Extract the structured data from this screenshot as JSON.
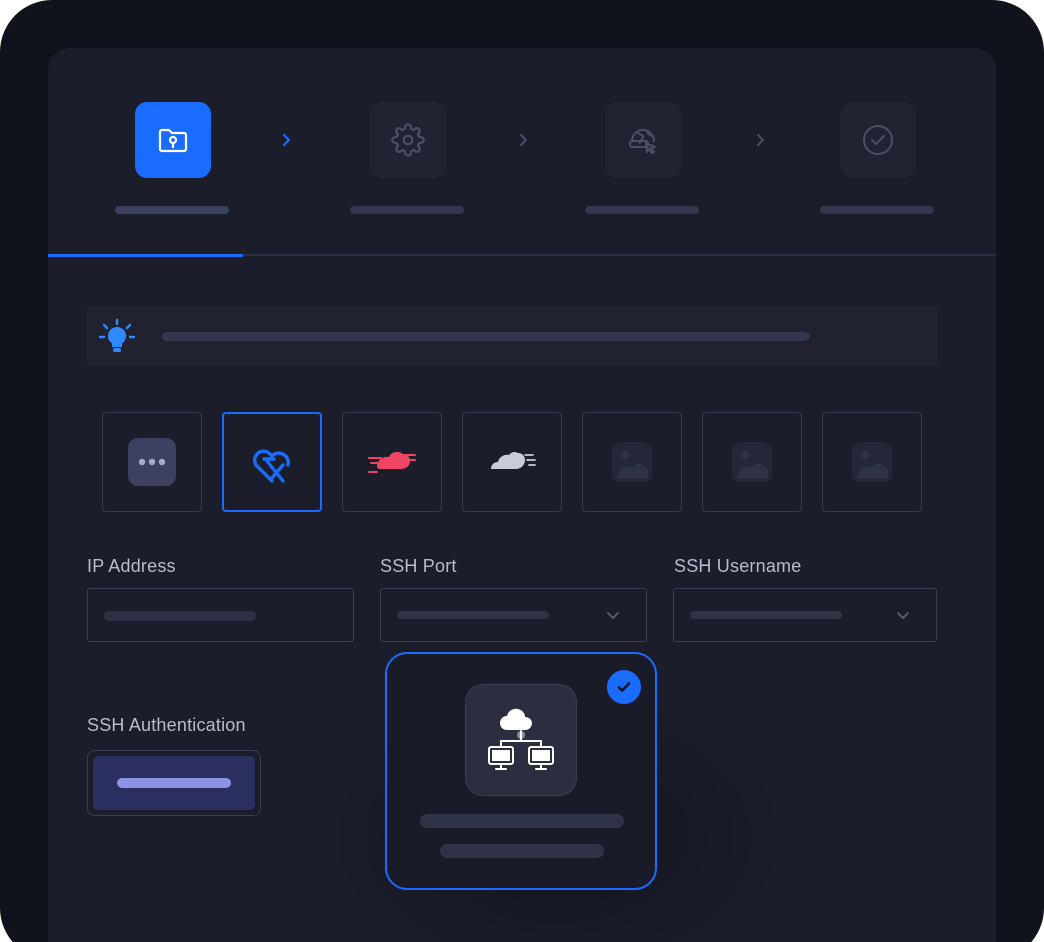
{
  "stepper": {
    "steps": [
      {
        "icon": "folder-key-icon",
        "active": true
      },
      {
        "icon": "gear-icon",
        "active": false
      },
      {
        "icon": "globe-cursor-icon",
        "active": false
      },
      {
        "icon": "check-circle-icon",
        "active": false
      }
    ],
    "progress_fraction": 0.2
  },
  "tip": {
    "icon": "lightbulb-icon"
  },
  "providers": [
    {
      "icon": "more-dots-icon",
      "selected": false
    },
    {
      "icon": "heart-x-logo-icon",
      "selected": true
    },
    {
      "icon": "red-speed-cloud-icon",
      "selected": false
    },
    {
      "icon": "grey-speed-cloud-icon",
      "selected": false
    },
    {
      "icon": "image-placeholder-icon",
      "selected": false
    },
    {
      "icon": "image-placeholder-icon",
      "selected": false
    },
    {
      "icon": "image-placeholder-icon",
      "selected": false
    }
  ],
  "form": {
    "ip_label": "IP Address",
    "port_label": "SSH Port",
    "username_label": "SSH Username",
    "auth_label": "SSH Authentication"
  },
  "card": {
    "icon": "cloud-network-icon",
    "selected": true
  },
  "colors": {
    "accent": "#1a6cff",
    "background": "#1b1d2b",
    "frame": "#10121c",
    "tip_icon": "#2e8bff",
    "alert_red": "#ef4565"
  }
}
